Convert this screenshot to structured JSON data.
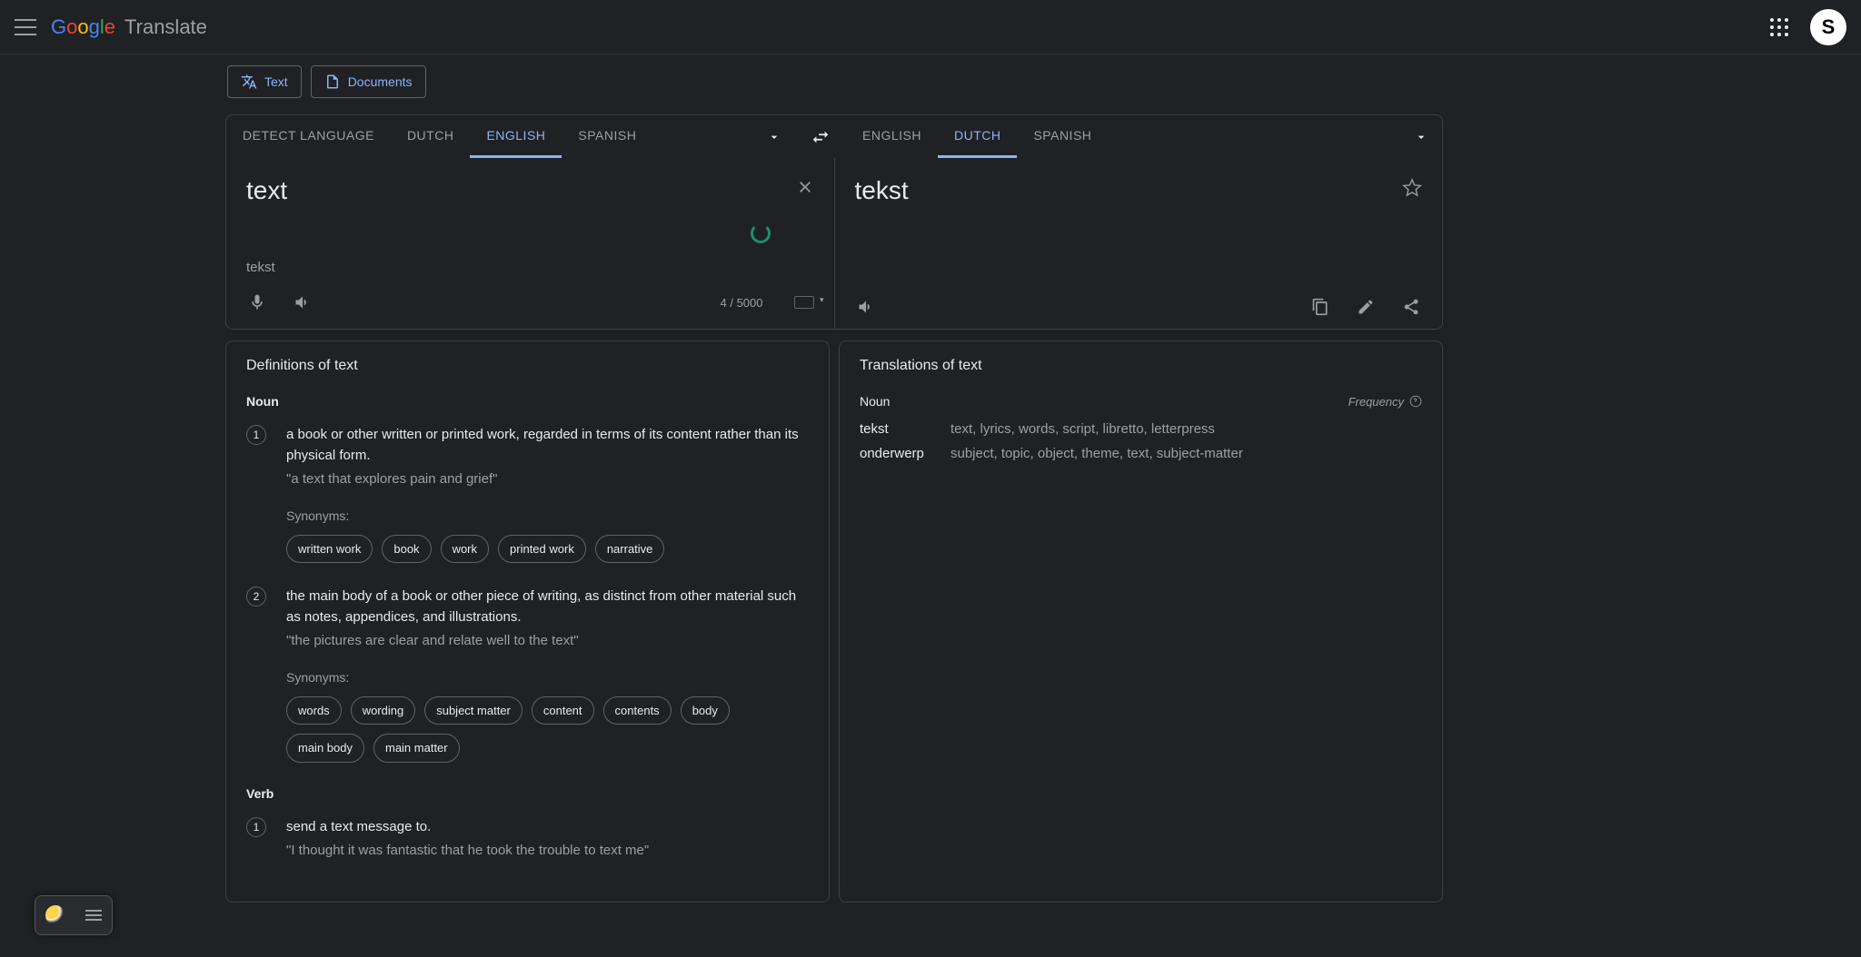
{
  "app": {
    "name": "Translate",
    "avatar_initial": "S"
  },
  "modes": {
    "text": "Text",
    "documents": "Documents"
  },
  "source_langs": {
    "detect": "DETECT LANGUAGE",
    "l1": "DUTCH",
    "l2": "ENGLISH",
    "l3": "SPANISH"
  },
  "target_langs": {
    "l1": "ENGLISH",
    "l2": "DUTCH",
    "l3": "SPANISH"
  },
  "source": {
    "value": "text",
    "suggestion": "tekst",
    "char_count": "4 / 5000"
  },
  "target": {
    "value": "tekst"
  },
  "definitions": {
    "heading": "Definitions of ",
    "word": "text",
    "noun_label": "Noun",
    "verb_label": "Verb",
    "syn_label": "Synonyms:",
    "noun": [
      {
        "num": "1",
        "text": "a book or other written or printed work, regarded in terms of its content rather than its physical form.",
        "example": "\"a text that explores pain and grief\"",
        "synonyms": [
          "written work",
          "book",
          "work",
          "printed work",
          "narrative"
        ]
      },
      {
        "num": "2",
        "text": "the main body of a book or other piece of writing, as distinct from other material such as notes, appendices, and illustrations.",
        "example": "\"the pictures are clear and relate well to the text\"",
        "synonyms": [
          "words",
          "wording",
          "subject matter",
          "content",
          "contents",
          "body",
          "main body",
          "main matter"
        ]
      }
    ],
    "verb": [
      {
        "num": "1",
        "text": "send a text message to.",
        "example": "\"I thought it was fantastic that he took the trouble to text me\""
      }
    ]
  },
  "translations": {
    "heading": "Translations of ",
    "word": "text",
    "frequency_label": "Frequency",
    "noun_label": "Noun",
    "rows": [
      {
        "word": "tekst",
        "synonyms": "text, lyrics, words, script, libretto, letterpress"
      },
      {
        "word": "onderwerp",
        "synonyms": "subject, topic, object, theme, text, subject-matter"
      }
    ]
  }
}
